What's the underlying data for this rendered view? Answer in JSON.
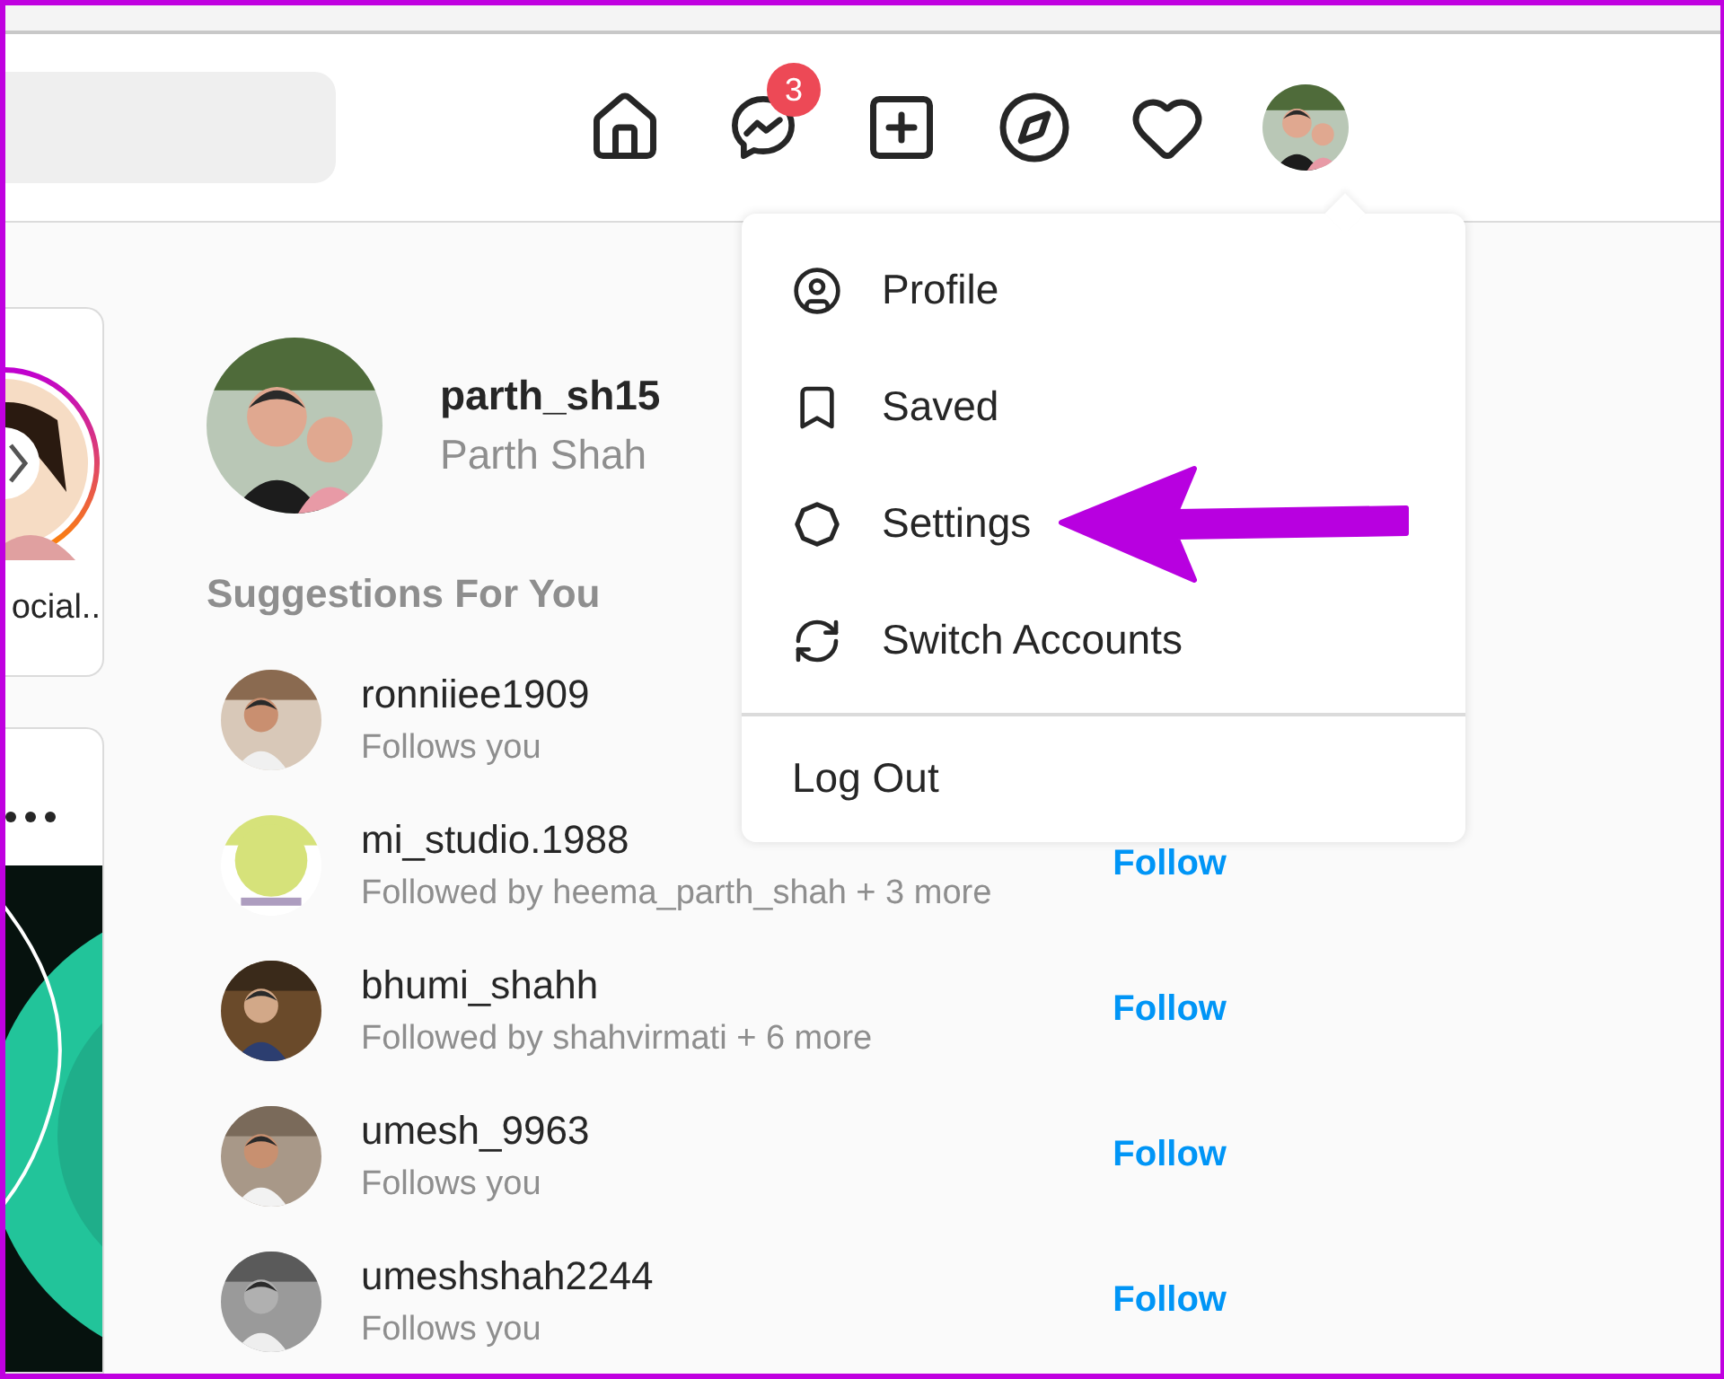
{
  "nav": {
    "messages_badge": "3"
  },
  "stories": [
    {
      "label": "ocial.."
    }
  ],
  "profile": {
    "username": "parth_sh15",
    "full_name": "Parth Shah"
  },
  "suggestions": {
    "title": "Suggestions For You",
    "items": [
      {
        "username": "ronniiee1909",
        "subtitle": "Follows you"
      },
      {
        "username": "mi_studio.1988",
        "subtitle": "Followed by heema_parth_shah + 3 more",
        "action": "Follow"
      },
      {
        "username": "bhumi_shahh",
        "subtitle": "Followed by shahvirmati + 6 more",
        "action": "Follow"
      },
      {
        "username": "umesh_9963",
        "subtitle": "Follows you",
        "action": "Follow"
      },
      {
        "username": "umeshshah2244",
        "subtitle": "Follows you",
        "action": "Follow"
      }
    ]
  },
  "menu": {
    "items": [
      {
        "kind": "profile",
        "label": "Profile"
      },
      {
        "kind": "saved",
        "label": "Saved"
      },
      {
        "kind": "settings",
        "label": "Settings"
      },
      {
        "kind": "switch",
        "label": "Switch Accounts"
      }
    ],
    "logout": "Log Out"
  }
}
